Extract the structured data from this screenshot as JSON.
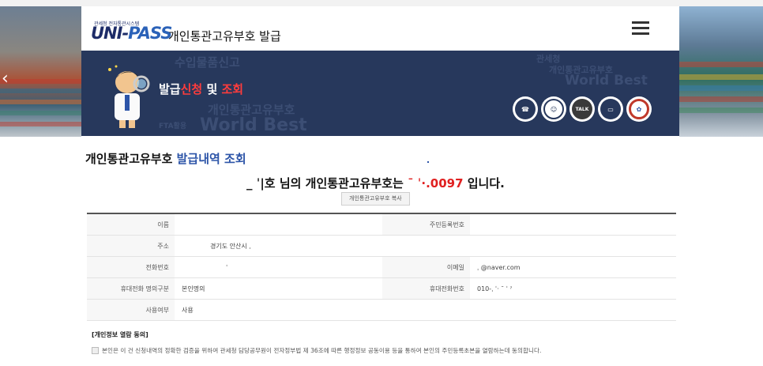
{
  "header": {
    "logo_small": "관세청 전자통관시스템",
    "logo_uni": "UNI-",
    "logo_pass": "PASS",
    "site_title": "개인통관고유부호 발급"
  },
  "banner": {
    "title_part1": "발급",
    "title_part2": "신청",
    "title_part3": " 및 ",
    "title_part4": "조회",
    "ghost_texts": [
      "수입물품신고",
      "개인통관고유부호",
      "World Best",
      "개인통관고유부호",
      "World Best",
      "관세청",
      "FTA활용"
    ],
    "icons": [
      "phone-icon",
      "chatbot-icon",
      "talk-icon",
      "remote-support-icon",
      "government-icon"
    ],
    "talk_label": "TALK"
  },
  "page": {
    "section_title_prefix": "개인통관고유부호 ",
    "section_title_highlight": "발급내역 조회",
    "result_name": "_ ˈ|호",
    "result_mid": " 님의 개인통관고유부호는 ",
    "result_number": "ˉ     ˈ·.0097",
    "result_suffix": " 입니다.",
    "copy_button": "개인통관고유부호 복사"
  },
  "info": {
    "name_label": "이름",
    "name_value": "",
    "rrn_label": "주민등록번호",
    "rrn_value": "",
    "address_label": "주소",
    "address_value": "경기도 안산시 ˌ",
    "phone_label": "전화번호",
    "phone_value": "ˈ",
    "email_label": "이메일",
    "email_value": "ˌ     @naver.com",
    "mobile_type_label": "휴대전화 명의구분",
    "mobile_type_value": "본인명의",
    "mobile_label": "휴대전화번호",
    "mobile_value": "010-ˌ  ˈ· ˉ ˈ ˀ",
    "usage_label": "사용여부",
    "usage_value": "사용"
  },
  "consent": {
    "title": "[개인정보 열람 동의]",
    "text": "본인은 이 건 신청내역의 정확한 검증을 위하여 관세청 담당공무원이 전자정부법 제 36조에 따른 행정정보 공동이용 등을 통하여 본인의 주민등록초본을 열람하는데 동의합니다."
  },
  "colors": {
    "brand_navy": "#27385c",
    "accent_red": "#ff3c3c",
    "link_blue": "#2d55a8"
  }
}
